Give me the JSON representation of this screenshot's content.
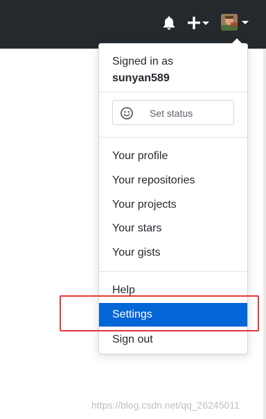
{
  "header": {
    "bell_icon": "bell-icon",
    "plus_icon": "plus-icon",
    "avatar_caret_icon": "chevron-down-icon",
    "background": "#24292e"
  },
  "dropdown": {
    "signed_in_label": "Signed in as",
    "username": "sunyan589",
    "set_status": {
      "icon": "smiley-icon",
      "label": "Set status"
    },
    "profile_items": [
      {
        "label": "Your profile"
      },
      {
        "label": "Your repositories"
      },
      {
        "label": "Your projects"
      },
      {
        "label": "Your stars"
      },
      {
        "label": "Your gists"
      }
    ],
    "account_items": [
      {
        "label": "Help"
      },
      {
        "label": "Settings",
        "active": true
      },
      {
        "label": "Sign out"
      }
    ],
    "active_color": "#0366d6"
  },
  "annotation": {
    "highlight_color": "#e53935"
  },
  "watermark": "https://blog.csdn.net/qq_26245011"
}
